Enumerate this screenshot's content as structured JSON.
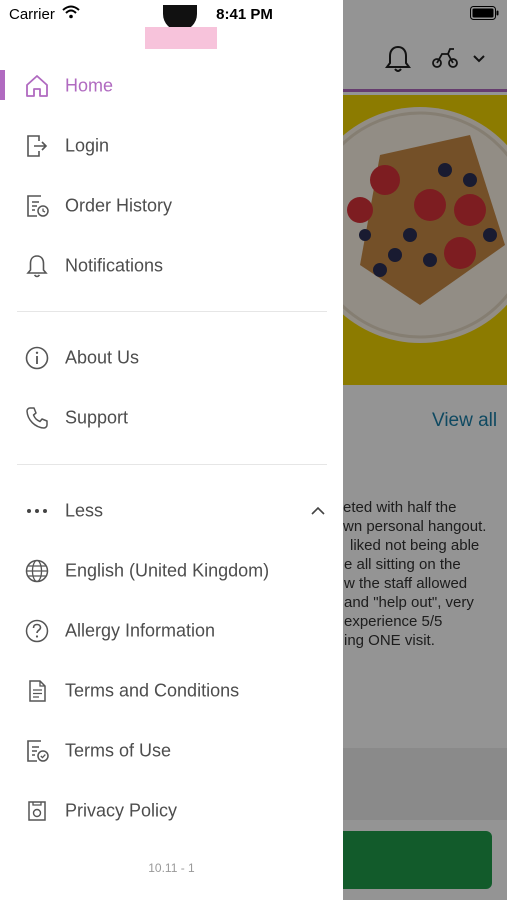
{
  "status_bar": {
    "carrier": "Carrier",
    "time": "8:41 PM"
  },
  "background": {
    "view_all": "View all",
    "review_lines": [
      "eted with half the",
      "wn personal hangout.",
      "liked not being able",
      "e all sitting on the",
      "w the staff allowed",
      "and \"help out\", very",
      "experience 5/5",
      "ing ONE visit."
    ]
  },
  "drawer": {
    "accent_color": "#b06ac0",
    "items_primary": [
      {
        "label": "Home",
        "icon": "home-icon",
        "active": true
      },
      {
        "label": "Login",
        "icon": "login-icon"
      },
      {
        "label": "Order History",
        "icon": "order-history-icon"
      },
      {
        "label": "Notifications",
        "icon": "bell-icon"
      }
    ],
    "items_secondary": [
      {
        "label": "About Us",
        "icon": "info-icon"
      },
      {
        "label": "Support",
        "icon": "phone-icon"
      }
    ],
    "less": {
      "label": "Less",
      "icon": "more-dots-icon"
    },
    "items_more": [
      {
        "label": "English (United Kingdom)",
        "icon": "globe-icon"
      },
      {
        "label": "Allergy Information",
        "icon": "question-icon"
      },
      {
        "label": "Terms and Conditions",
        "icon": "document-icon"
      },
      {
        "label": "Terms of Use",
        "icon": "document-check-icon"
      },
      {
        "label": "Privacy Policy",
        "icon": "privacy-icon"
      }
    ],
    "version": "10.11 - 1"
  }
}
